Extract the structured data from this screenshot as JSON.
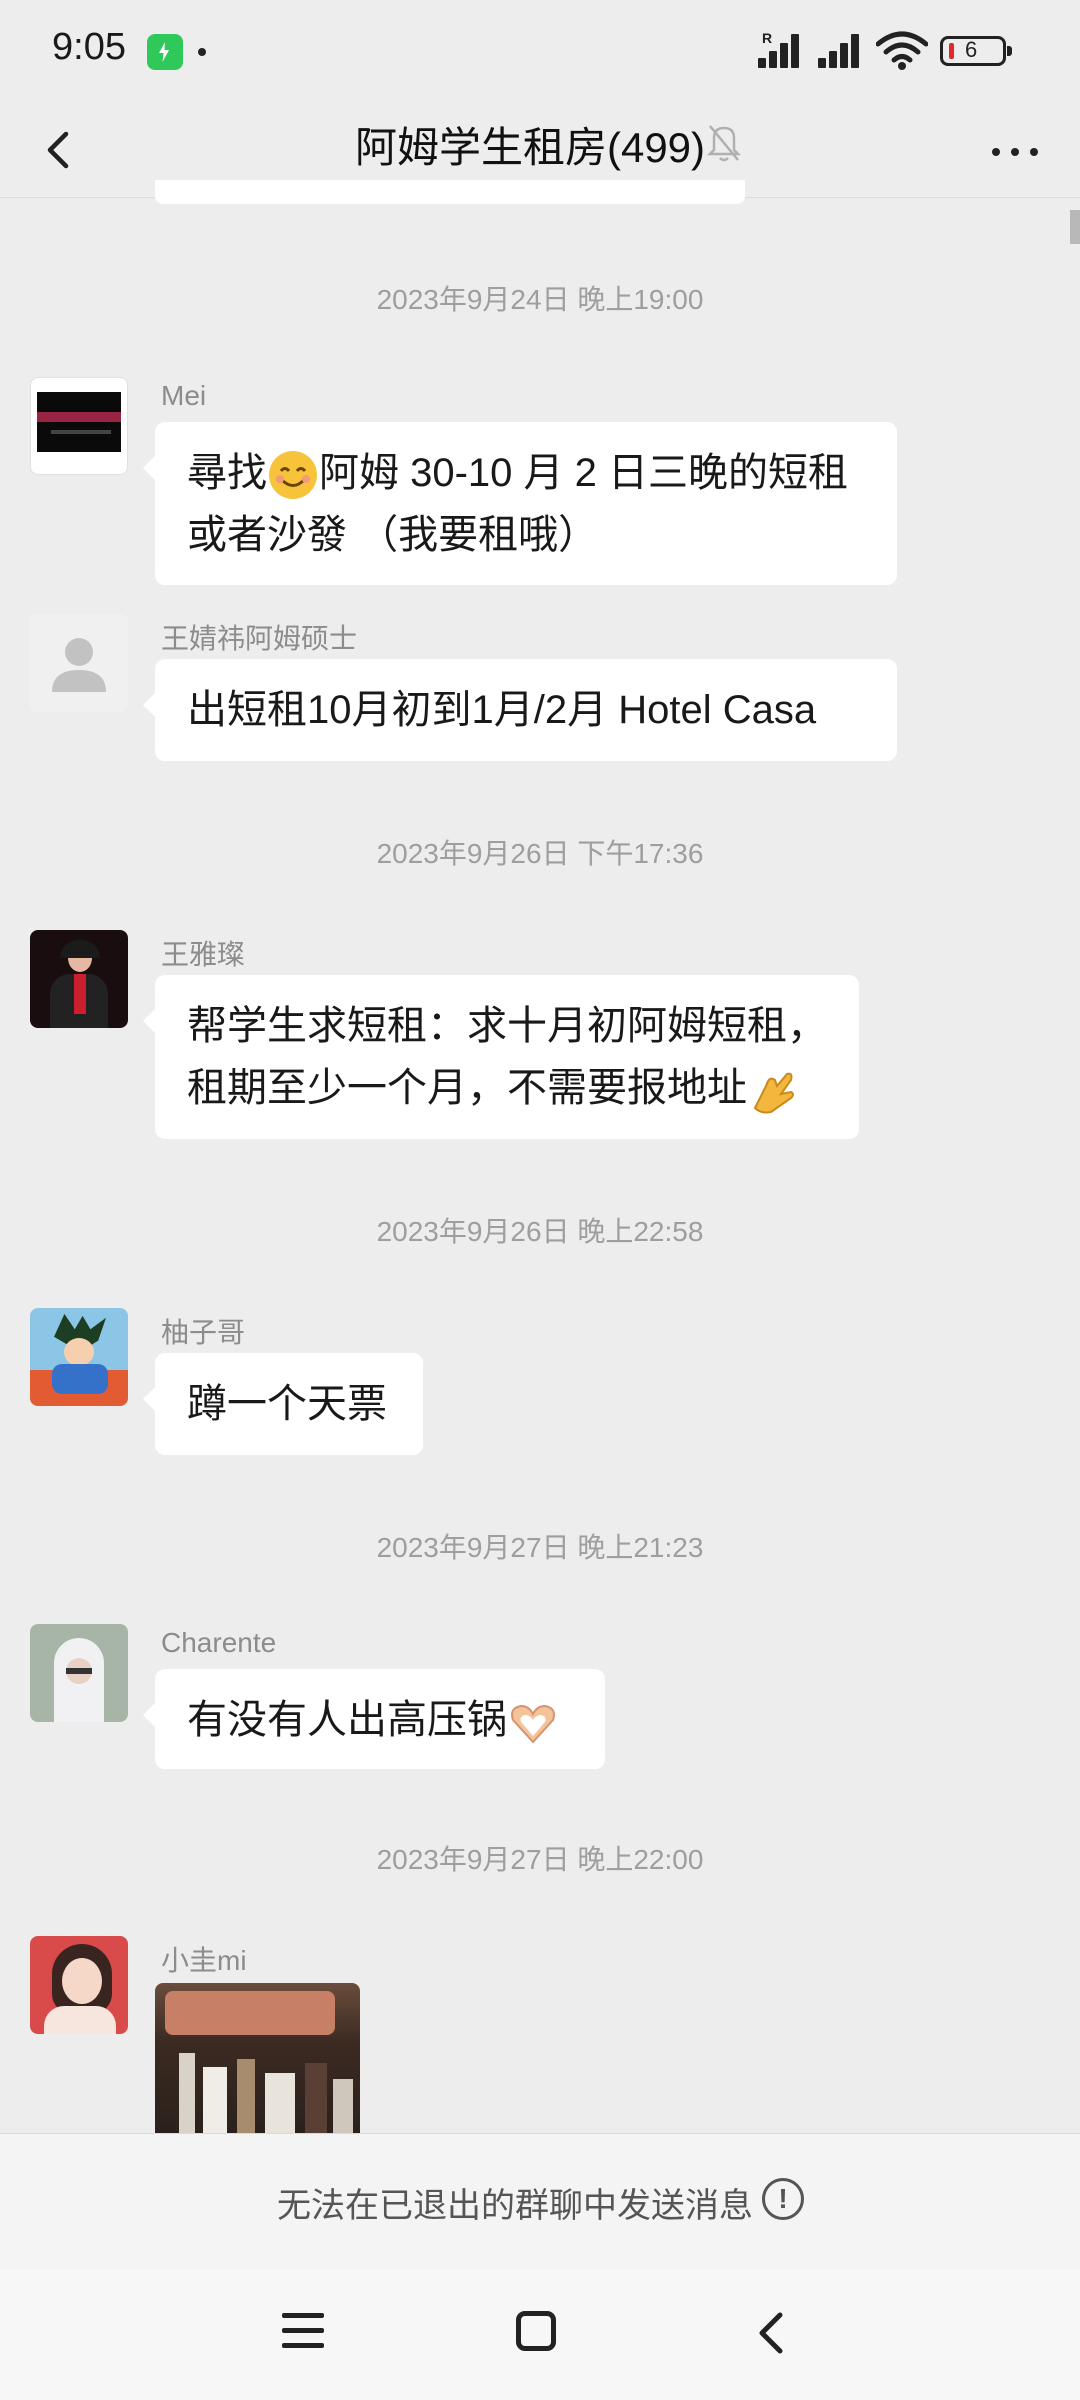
{
  "status_bar": {
    "time": "9:05",
    "battery_level": "6",
    "signal_label": "R",
    "icons": [
      "app-notification-icon",
      "signal-icon",
      "wifi-icon",
      "battery-icon"
    ]
  },
  "header": {
    "title": "阿姆学生租房(499)",
    "icons": [
      "back-icon",
      "mute-bell-icon",
      "more-icon"
    ]
  },
  "messages": [
    {
      "time": "2023年9月24日 晚上19:00",
      "sender": "Mei",
      "line1": "尋找",
      "line1b": "阿姆 30-10 月 2 日三晚的短租",
      "line2": "或者沙發 （我要租哦）",
      "emoji": "smiling-face-icon"
    },
    {
      "sender": "王婧祎阿姆硕士",
      "text": "出短租10月初到1月/2月 Hotel Casa"
    },
    {
      "time": "2023年9月26日 下午17:36",
      "sender": "王雅璨",
      "line1": "帮学生求短租：求十月初阿姆短租，",
      "line2": "租期至少一个月，不需要报地址",
      "emoji": "ok-hand-icon"
    },
    {
      "time": "2023年9月26日 晚上22:58",
      "sender": "柚子哥",
      "text": "蹲一个天票"
    },
    {
      "time": "2023年9月27日 晚上21:23",
      "sender": "Charente",
      "text": "有没有人出高压锅",
      "emoji": "heart-hands-icon"
    },
    {
      "time": "2023年9月27日 晚上22:00",
      "sender": "小圭mi",
      "type": "image"
    }
  ],
  "notice": {
    "text": "无法在已退出的群聊中发送消息",
    "icon": "info-icon"
  },
  "nav_bar": {
    "icons": [
      "menu-icon",
      "home-icon",
      "back-icon"
    ]
  },
  "colors": {
    "background": "#ededed",
    "bubble": "#ffffff",
    "timestamp": "#9e9e9e",
    "sender": "#8c8c8c"
  }
}
